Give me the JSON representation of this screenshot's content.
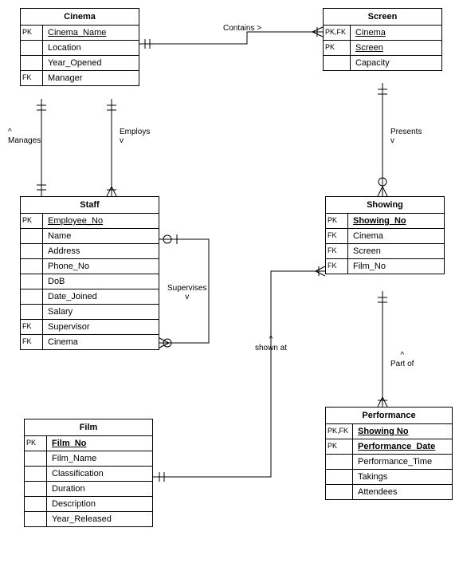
{
  "entities": {
    "cinema": {
      "title": "Cinema",
      "rows": [
        {
          "key": "PK",
          "attr": "Cinema_Name",
          "underline": true
        },
        {
          "key": "",
          "attr": "Location"
        },
        {
          "key": "",
          "attr": "Year_Opened"
        },
        {
          "key": "FK",
          "attr": "Manager"
        }
      ]
    },
    "screen": {
      "title": "Screen",
      "rows": [
        {
          "key": "PK,FK",
          "attr": "Cinema",
          "underline": true
        },
        {
          "key": "PK",
          "attr": "Screen",
          "underline": true
        },
        {
          "key": "",
          "attr": "Capacity"
        }
      ]
    },
    "staff": {
      "title": "Staff",
      "rows": [
        {
          "key": "PK",
          "attr": "Employee_No",
          "underline": true
        },
        {
          "key": "",
          "attr": "Name"
        },
        {
          "key": "",
          "attr": "Address"
        },
        {
          "key": "",
          "attr": "Phone_No"
        },
        {
          "key": "",
          "attr": "DoB"
        },
        {
          "key": "",
          "attr": "Date_Joined"
        },
        {
          "key": "",
          "attr": "Salary"
        },
        {
          "key": "FK",
          "attr": "Supervisor"
        },
        {
          "key": "FK",
          "attr": "Cinema"
        }
      ]
    },
    "showing": {
      "title": "Showing",
      "rows": [
        {
          "key": "PK",
          "attr": "Showing_No",
          "underline": true,
          "bold": true
        },
        {
          "key": "FK",
          "attr": "Cinema"
        },
        {
          "key": "FK",
          "attr": "Screen"
        },
        {
          "key": "FK",
          "attr": "Film_No"
        }
      ]
    },
    "film": {
      "title": "Film",
      "rows": [
        {
          "key": "PK",
          "attr": "Film_No",
          "underline": true,
          "bold": true
        },
        {
          "key": "",
          "attr": "Film_Name"
        },
        {
          "key": "",
          "attr": "Classification"
        },
        {
          "key": "",
          "attr": "Duration"
        },
        {
          "key": "",
          "attr": "Description"
        },
        {
          "key": "",
          "attr": "Year_Released"
        }
      ]
    },
    "performance": {
      "title": "Performance",
      "rows": [
        {
          "key": "PK,FK",
          "attr": "Showing No",
          "underline": true,
          "bold": true
        },
        {
          "key": "PK",
          "attr": "Performance_Date",
          "underline": true,
          "bold": true
        },
        {
          "key": "",
          "attr": "Performance_Time"
        },
        {
          "key": "",
          "attr": "Takings"
        },
        {
          "key": "",
          "attr": "Attendees"
        }
      ]
    }
  },
  "labels": {
    "contains": "Contains >",
    "manages": "^\nManages",
    "employs": "Employs\nv",
    "supervises": "Supervises\nv",
    "presents": "Presents\nv",
    "shown_at": "^\nshown at",
    "part_of": "^\nPart of"
  }
}
